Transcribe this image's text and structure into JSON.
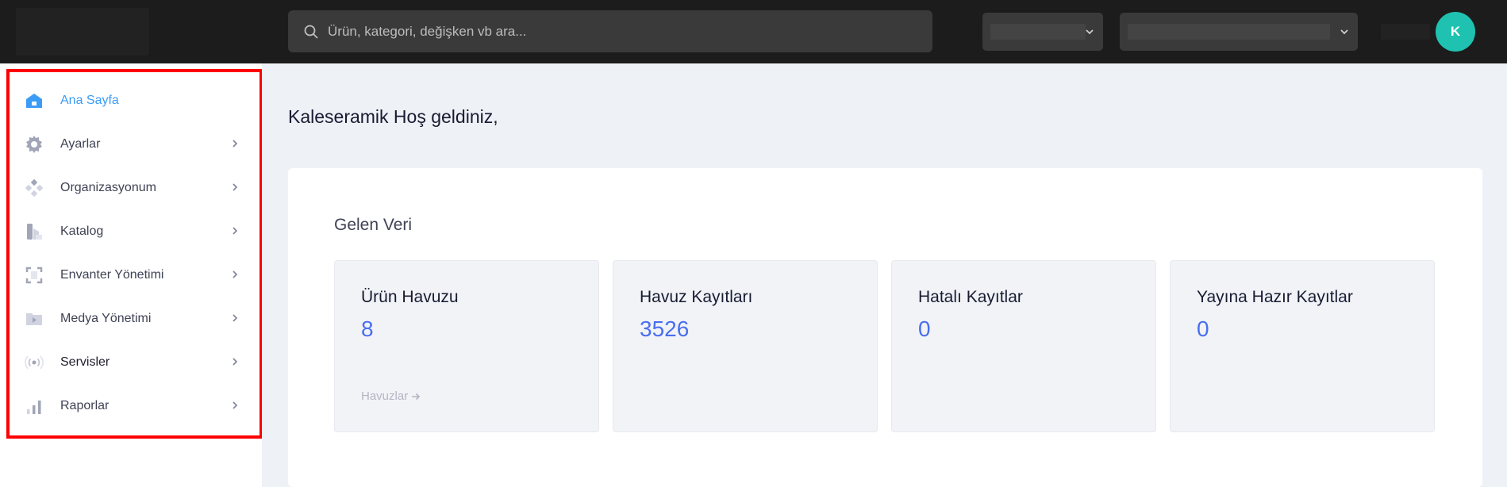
{
  "topbar": {
    "search_placeholder": "Ürün, kategori, değişken vb ara...",
    "avatar_initial": "K",
    "accent": "#1fc2b1"
  },
  "sidebar": {
    "items": [
      {
        "label": "Ana Sayfa",
        "icon": "home-icon",
        "active": true
      },
      {
        "label": "Ayarlar",
        "icon": "gear-icon"
      },
      {
        "label": "Organizasyonum",
        "icon": "organization-icon"
      },
      {
        "label": "Katalog",
        "icon": "catalog-icon"
      },
      {
        "label": "Envanter Yönetimi",
        "icon": "inventory-icon"
      },
      {
        "label": "Medya Yönetimi",
        "icon": "media-icon"
      },
      {
        "label": "Servisler",
        "icon": "services-icon"
      },
      {
        "label": "Raporlar",
        "icon": "reports-icon"
      }
    ],
    "active_color": "#3b9cf5"
  },
  "main": {
    "welcome": "Kaleseramik Hoş geldiniz,",
    "section_title": "Gelen Veri",
    "stats": [
      {
        "label": "Ürün Havuzu",
        "value": "8",
        "link": "Havuzlar"
      },
      {
        "label": "Havuz Kayıtları",
        "value": "3526"
      },
      {
        "label": "Hatalı Kayıtlar",
        "value": "0"
      },
      {
        "label": "Yayına Hazır Kayıtlar",
        "value": "0"
      }
    ],
    "value_color": "#4a6ef0"
  }
}
